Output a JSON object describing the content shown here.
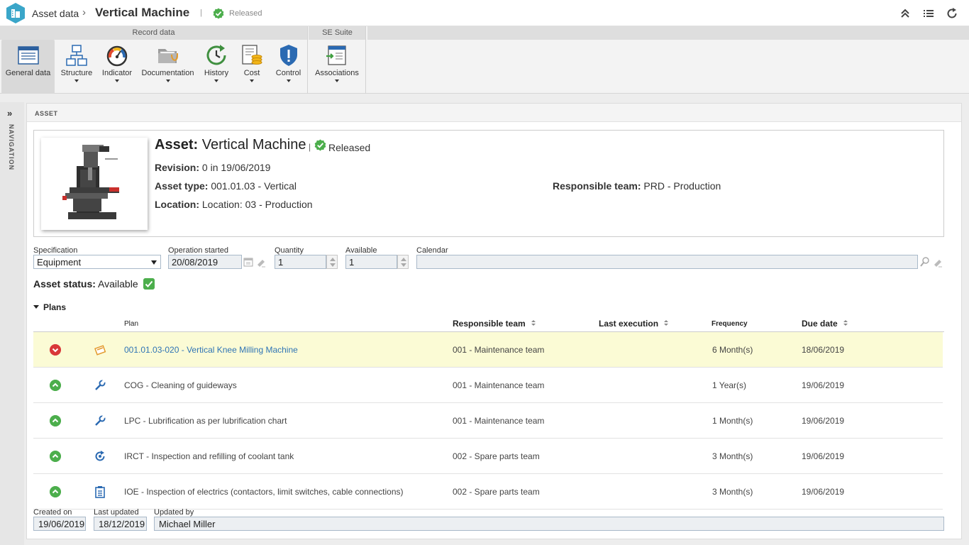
{
  "header": {
    "breadcrumb_root": "Asset data",
    "breadcrumb_sep": "›",
    "title": "Vertical Machine",
    "divider": "|",
    "status": "Released"
  },
  "ribbon": {
    "group_record": "Record data",
    "group_suite": "SE Suite",
    "buttons": [
      {
        "label": "General data",
        "icon": "general-data-icon",
        "active": true
      },
      {
        "label": "Structure",
        "icon": "structure-icon"
      },
      {
        "label": "Indicator",
        "icon": "gauge-icon"
      },
      {
        "label": "Documentation",
        "icon": "folder-icon"
      },
      {
        "label": "History",
        "icon": "history-clock-icon"
      },
      {
        "label": "Cost",
        "icon": "cost-coins-icon"
      },
      {
        "label": "Control",
        "icon": "shield-alert-icon"
      },
      {
        "label": "Associations",
        "icon": "associations-icon"
      }
    ]
  },
  "nav": {
    "label": "NAVIGATION"
  },
  "panel": {
    "title": "ASSET"
  },
  "asset": {
    "heading_label": "Asset:",
    "heading_value": "Vertical Machine",
    "divider": "|",
    "status": "Released",
    "revision_label": "Revision:",
    "revision_value": "0 in 19/06/2019",
    "type_label": "Asset type:",
    "type_value": "001.01.03 - Vertical",
    "location_label": "Location:",
    "location_value": "Location: 03 - Production",
    "team_label": "Responsible team:",
    "team_value": "PRD - Production"
  },
  "form": {
    "specification_label": "Specification",
    "specification_value": "Equipment",
    "operation_label": "Operation started",
    "operation_value": "20/08/2019",
    "quantity_label": "Quantity",
    "quantity_value": "1",
    "available_label": "Available",
    "available_value": "1",
    "calendar_label": "Calendar",
    "calendar_value": ""
  },
  "status": {
    "label": "Asset status:",
    "value": "Available"
  },
  "plans": {
    "toggle_label": "Plans",
    "columns": {
      "plan": "Plan",
      "team": "Responsible team",
      "last": "Last execution",
      "frequency": "Frequency",
      "due": "Due date"
    },
    "rows": [
      {
        "state": "red",
        "type_icon": "calendar-warning-icon",
        "plan": "001.01.03-020 - Vertical Knee Milling Machine",
        "team": "001 - Maintenance team",
        "last": "",
        "frequency": "6 Month(s)",
        "due": "18/06/2019",
        "highlight": true
      },
      {
        "state": "green",
        "type_icon": "wrench-icon",
        "plan": "COG - Cleaning of guideways",
        "team": "001 - Maintenance team",
        "last": "",
        "frequency": "1 Year(s)",
        "due": "19/06/2019"
      },
      {
        "state": "green",
        "type_icon": "wrench-icon",
        "plan": "LPC - Lubrification as per lubrification chart",
        "team": "001 - Maintenance team",
        "last": "",
        "frequency": "1 Month(s)",
        "due": "19/06/2019"
      },
      {
        "state": "green",
        "type_icon": "refresh-gear-icon",
        "plan": "IRCT - Inspection and refilling of coolant tank",
        "team": "002 - Spare parts team",
        "last": "",
        "frequency": "3 Month(s)",
        "due": "19/06/2019"
      },
      {
        "state": "green",
        "type_icon": "clipboard-icon",
        "plan": "IOE - Inspection of electrics (contactors, limit switches, cable connections)",
        "team": "002 - Spare parts team",
        "last": "",
        "frequency": "3 Month(s)",
        "due": "19/06/2019"
      }
    ]
  },
  "footer": {
    "created_label": "Created on",
    "created_value": "19/06/2019",
    "updated_label": "Last updated",
    "updated_value": "18/12/2019",
    "by_label": "Updated by",
    "by_value": "Michael Miller"
  },
  "colors": {
    "brand_teal": "#3aa6c9",
    "released_green": "#4cae4c",
    "overdue_red": "#d9383a",
    "link_blue": "#2f74b5",
    "row_highlight": "#fbfbd5"
  }
}
